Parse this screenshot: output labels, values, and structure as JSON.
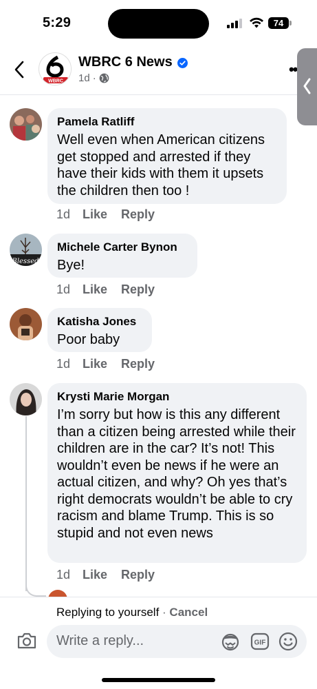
{
  "status_bar": {
    "time": "5:29",
    "battery": "74"
  },
  "header": {
    "page_name": "WBRC 6 News",
    "logo_text": "WBRC",
    "age": "1d",
    "separator": "·"
  },
  "comments": [
    {
      "author": "Pamela Ratliff",
      "text": "Well even when American citizens get stopped and arrested if they have their kids with them it upsets the children then too !",
      "age": "1d",
      "like": "Like",
      "reply": "Reply"
    },
    {
      "author": "Michele Carter Bynon",
      "text": "Bye!",
      "age": "1d",
      "like": "Like",
      "reply": "Reply",
      "avatar_text": "Blessed"
    },
    {
      "author": "Katisha Jones",
      "text": "Poor baby",
      "age": "1d",
      "like": "Like",
      "reply": "Reply"
    },
    {
      "author": "Krysti Marie Morgan",
      "text": "I’m sorry but how is this any different than a citizen being arrested while their children are in the car? It’s not! This wouldn’t even be news if he were an actual citizen, and why? Oh yes that’s right democrats wouldn’t be able to cry racism and blame Trump. This is so stupid and not even news",
      "age": "1d",
      "like": "Like",
      "reply": "Reply"
    }
  ],
  "composer": {
    "replying_to": "Replying to yourself",
    "separator": " · ",
    "cancel": "Cancel",
    "placeholder": "Write a reply...",
    "gif_label": "GIF"
  },
  "colors": {
    "accent_blue": "#0866ff",
    "bubble": "#f0f2f5",
    "muted_text": "#65676b",
    "logo_red": "#d2232a"
  },
  "icons": [
    "back-chevron-icon",
    "verified-badge-icon",
    "globe-icon",
    "more-icon",
    "camera-icon",
    "avatar-sticker-icon",
    "gif-icon",
    "emoji-icon"
  ]
}
